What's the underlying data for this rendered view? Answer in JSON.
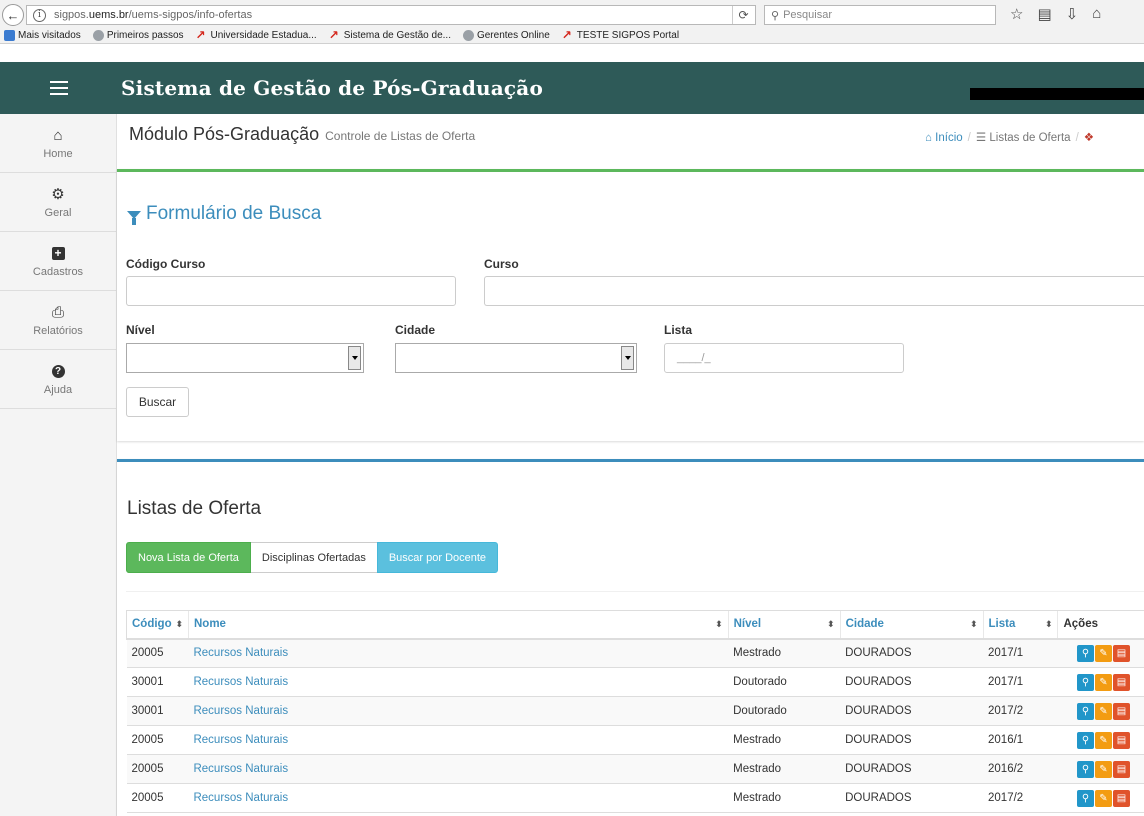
{
  "browser": {
    "url_prefix": "sigpos.",
    "url_host": "uems.br",
    "url_path": "/uems-sigpos/info-ofertas",
    "search_placeholder": "Pesquisar",
    "bookmarks": [
      {
        "label": "Mais visitados",
        "icon": "blue"
      },
      {
        "label": "Primeiros passos",
        "icon": "globe"
      },
      {
        "label": "Universidade Estadua...",
        "icon": "red"
      },
      {
        "label": "Sistema de Gestão de...",
        "icon": "red"
      },
      {
        "label": "Gerentes Online",
        "icon": "globe"
      },
      {
        "label": "TESTE SIGPOS Portal",
        "icon": "red"
      }
    ]
  },
  "header": {
    "title": "Sistema de Gestão de Pós-Graduação"
  },
  "sidebar": {
    "items": [
      {
        "label": "Home",
        "icon": "home-icon"
      },
      {
        "label": "Geral",
        "icon": "cogs-icon"
      },
      {
        "label": "Cadastros",
        "icon": "plus-square-icon"
      },
      {
        "label": "Relatórios",
        "icon": "print-icon"
      },
      {
        "label": "Ajuda",
        "icon": "help-icon"
      }
    ]
  },
  "page": {
    "title": "Módulo Pós-Graduação",
    "subtitle": "Controle de Listas de Oferta",
    "breadcrumb": {
      "home": "Início",
      "current": "Listas de Oferta"
    }
  },
  "search_form": {
    "title": "Formulário de Busca",
    "codigo_label": "Código Curso",
    "curso_label": "Curso",
    "nivel_label": "Nível",
    "cidade_label": "Cidade",
    "lista_label": "Lista",
    "lista_placeholder": "____/_",
    "submit_label": "Buscar"
  },
  "list": {
    "title": "Listas de Oferta",
    "buttons": {
      "new": "Nova Lista de Oferta",
      "disciplinas": "Disciplinas Ofertadas",
      "docente": "Buscar por Docente"
    },
    "columns": {
      "codigo": "Código",
      "nome": "Nome",
      "nivel": "Nível",
      "cidade": "Cidade",
      "lista": "Lista",
      "acoes": "Ações"
    },
    "rows": [
      {
        "codigo": "20005",
        "nome": "Recursos Naturais",
        "nivel": "Mestrado",
        "cidade": "DOURADOS",
        "lista": "2017/1"
      },
      {
        "codigo": "30001",
        "nome": "Recursos Naturais",
        "nivel": "Doutorado",
        "cidade": "DOURADOS",
        "lista": "2017/1"
      },
      {
        "codigo": "30001",
        "nome": "Recursos Naturais",
        "nivel": "Doutorado",
        "cidade": "DOURADOS",
        "lista": "2017/2"
      },
      {
        "codigo": "20005",
        "nome": "Recursos Naturais",
        "nivel": "Mestrado",
        "cidade": "DOURADOS",
        "lista": "2016/1"
      },
      {
        "codigo": "20005",
        "nome": "Recursos Naturais",
        "nivel": "Mestrado",
        "cidade": "DOURADOS",
        "lista": "2016/2"
      },
      {
        "codigo": "20005",
        "nome": "Recursos Naturais",
        "nivel": "Mestrado",
        "cidade": "DOURADOS",
        "lista": "2017/2"
      }
    ]
  },
  "colors": {
    "header_bg": "#2e5a58",
    "accent_blue": "#3c8dbc",
    "accent_green": "#5cb85c",
    "accent_teal": "#5bc0de"
  }
}
